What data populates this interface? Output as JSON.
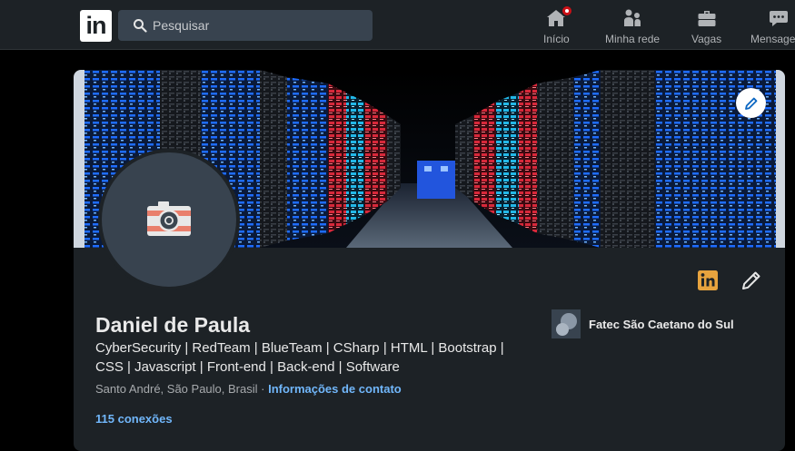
{
  "nav": {
    "logo_text": "in",
    "search_placeholder": "Pesquisar",
    "items": [
      {
        "label": "Início",
        "icon": "home-icon",
        "has_notification": true
      },
      {
        "label": "Minha rede",
        "icon": "network-icon"
      },
      {
        "label": "Vagas",
        "icon": "briefcase-icon"
      },
      {
        "label": "Mensagens",
        "icon": "messaging-icon"
      }
    ]
  },
  "profile": {
    "name": "Daniel de Paula",
    "headline": "CyberSecurity | RedTeam | BlueTeam | CSharp | HTML | Bootstrap | CSS | Javascript | Front-end | Back-end | Software",
    "location": "Santo André, São Paulo, Brasil",
    "separator": " · ",
    "contact_info_label": "Informações de contato",
    "connections": "115 conexões",
    "education": "Fatec São Caetano do Sul"
  },
  "colors": {
    "nav_bg": "#1d2226",
    "card_bg": "#1d2226",
    "link": "#71b7fb",
    "notification": "#cc1016",
    "linkedin_badge": "#e7a33e"
  }
}
